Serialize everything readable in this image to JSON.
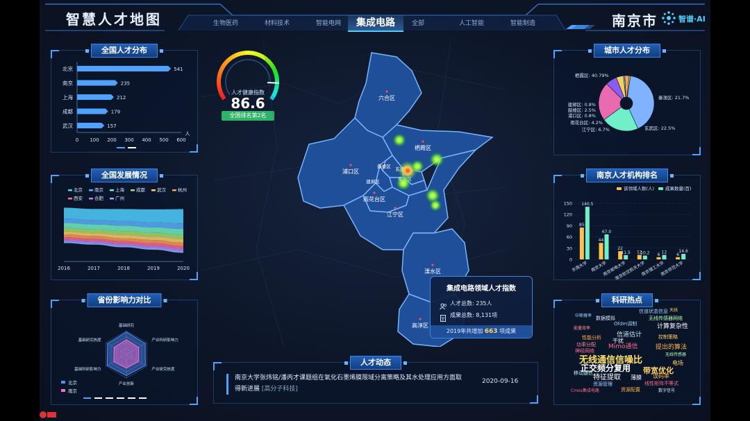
{
  "header": {
    "title": "智慧人才地图",
    "city": "南京市",
    "brand": "智谱·AI",
    "tabs": [
      {
        "label": "生物医药",
        "active": false
      },
      {
        "label": "材料技术",
        "active": false
      },
      {
        "label": "智能电网",
        "active": false
      },
      {
        "label": "集成电路",
        "active": true
      },
      {
        "label": "全部",
        "active": false
      },
      {
        "label": "人工智能",
        "active": false
      },
      {
        "label": "智能制造",
        "active": false
      }
    ]
  },
  "national": {
    "title": "全国人才分布",
    "unit": "人",
    "xticks": [
      "0",
      "100",
      "200",
      "300",
      "400",
      "500",
      "600"
    ]
  },
  "development": {
    "title": "全国发展情况",
    "legend": [
      "北京",
      "南京",
      "上海",
      "成都",
      "武汉",
      "杭州",
      "西安",
      "合肥",
      "广州"
    ],
    "years": [
      "2016",
      "2017",
      "2018",
      "2019",
      "2020"
    ]
  },
  "province": {
    "title": "省份影响力对比",
    "axes": [
      "基础研究",
      "产业科研影响力",
      "产业研究热度",
      "产业创新",
      "基础科研影响力",
      "基础研究热度"
    ],
    "legend": [
      "北京",
      "南京"
    ]
  },
  "gauge": {
    "label": "人才健康指数",
    "value": "86.6",
    "rank": "全国排名第2名"
  },
  "map": {
    "districts": [
      "六合区",
      "栖霞区",
      "浦口区",
      "鼓楼区",
      "玄武区",
      "建邺区",
      "秦淮区",
      "雨花台区",
      "江宁区",
      "溧水区",
      "高淳区"
    ]
  },
  "talent_index": {
    "title": "集成电路领域人才指数",
    "total_label": "人才总数: 235人",
    "output_label": "成果总数: 8,131项",
    "footer_prefix": "2019年共增加",
    "footer_value": "663",
    "footer_suffix": "项成果"
  },
  "news": {
    "title": "人才动态",
    "text": "南京大学张炜铭/潘丙才课题组在氧化石墨烯膜限域分离策略及其水处理应用方面取得新进展",
    "tag": "[高分子科技]",
    "date": "2020-09-16"
  },
  "city_distribution": {
    "title": "城市人才分布",
    "slices": [
      {
        "name": "栖霞区",
        "label": "栖霞区: 40.79%",
        "value": 40.79,
        "color": "#7fb3ff"
      },
      {
        "name": "秦淮区",
        "label": "秦淮区: 21.7%",
        "value": 21.7,
        "color": "#6ff0c8"
      },
      {
        "name": "玄武区",
        "label": "玄武区: 22.5%",
        "value": 22.5,
        "color": "#e86bb0"
      },
      {
        "name": "江宁区",
        "label": "江宁区: 6.7%",
        "value": 6.7,
        "color": "#8a5cf0"
      },
      {
        "name": "雨花台区",
        "label": "雨花台区: 4.2%",
        "value": 4.2,
        "color": "#f0d060"
      },
      {
        "name": "浦口区",
        "label": "浦口区: 0.8%",
        "value": 0.8,
        "color": "#4fd0ff"
      },
      {
        "name": "鼓楼区",
        "label": "鼓楼区: 2.5%",
        "value": 2.5,
        "color": "#ff9b5c"
      },
      {
        "name": "建邺区",
        "label": "建邺区: 0.8%",
        "value": 0.8,
        "color": "#b0e060"
      }
    ]
  },
  "institution": {
    "title": "南京人才机构排名",
    "legend": [
      "该领域人数(人)",
      "成果数量(百)"
    ],
    "yticks": [
      "0",
      "30",
      "60",
      "90",
      "120",
      "150"
    ]
  },
  "hotwords": {
    "title": "科研热点",
    "words": [
      {
        "text": "无线通信信噪比",
        "color": "#ffe066"
      },
      {
        "text": "正交频分复用",
        "color": "#ffffff"
      },
      {
        "text": "带宽优化",
        "color": "#ffd166"
      },
      {
        "text": "Mimo通信",
        "color": "#ff6b8b"
      },
      {
        "text": "提出的算法",
        "color": "#ffb347"
      },
      {
        "text": "特征提取",
        "color": "#ffffff"
      },
      {
        "text": "计算复杂性",
        "color": "#ffffff"
      },
      {
        "text": "信道估计",
        "color": "#c3f0ff"
      },
      {
        "text": "Ofdm调制",
        "color": "#9ad0ff"
      },
      {
        "text": "无线传感器网络",
        "color": "#b6ffb0"
      },
      {
        "text": "数据模拟",
        "color": "#e0e0ff"
      },
      {
        "text": "信道状态信息",
        "color": "#9ad0ff"
      },
      {
        "text": "性能分析",
        "color": "#ffb347"
      },
      {
        "text": "功率分配",
        "color": "#ff8f8f"
      },
      {
        "text": "干扰",
        "color": "#ffffff"
      },
      {
        "text": "控制策略",
        "color": "#ffd166"
      },
      {
        "text": "神经网络",
        "color": "#ff6b8b"
      },
      {
        "text": "资源管理",
        "color": "#9ad0ff"
      },
      {
        "text": "薄膜",
        "color": "#ffffff"
      },
      {
        "text": "误码率",
        "color": "#ffb347"
      },
      {
        "text": "移动通信",
        "color": "#c3f0ff"
      },
      {
        "text": "线性矩阵不等式",
        "color": "#ff6b8b"
      },
      {
        "text": "资源配置",
        "color": "#ffb347"
      },
      {
        "text": "电场",
        "color": "#ffd166"
      },
      {
        "text": "中断概率",
        "color": "#9ad0ff"
      },
      {
        "text": "能量效率",
        "color": "#ff8f8f"
      },
      {
        "text": "无线传感器",
        "color": "#b6ffb0"
      },
      {
        "text": "数字信号",
        "color": "#e0e0ff"
      },
      {
        "text": "天线",
        "color": "#ffd166"
      },
      {
        "text": "Cmos集成电路",
        "color": "#ff6b8b"
      }
    ]
  },
  "chart_data": [
    {
      "type": "bar",
      "title": "全国人才分布",
      "categories": [
        "北京",
        "南京",
        "上海",
        "成都",
        "武汉"
      ],
      "values": [
        541,
        235,
        212,
        179,
        157
      ],
      "xlim": [
        0,
        600
      ],
      "orientation": "horizontal"
    },
    {
      "type": "area",
      "title": "全国发展情况",
      "x": [
        "2016",
        "2017",
        "2018",
        "2019",
        "2020"
      ],
      "series": [
        {
          "name": "北京",
          "values": [
            30,
            31,
            33,
            36,
            40
          ]
        },
        {
          "name": "南京",
          "values": [
            12,
            12,
            13,
            14,
            15
          ]
        },
        {
          "name": "上海",
          "values": [
            14,
            14,
            15,
            15,
            16
          ]
        },
        {
          "name": "成都",
          "values": [
            10,
            10,
            11,
            11,
            12
          ]
        },
        {
          "name": "武汉",
          "values": [
            8,
            8,
            9,
            9,
            10
          ]
        },
        {
          "name": "杭州",
          "values": [
            8,
            8,
            8,
            9,
            9
          ]
        },
        {
          "name": "西安",
          "values": [
            6,
            6,
            7,
            7,
            7
          ]
        },
        {
          "name": "合肥",
          "values": [
            5,
            5,
            5,
            6,
            6
          ]
        },
        {
          "name": "广州",
          "values": [
            5,
            5,
            5,
            5,
            6
          ]
        }
      ],
      "colors": [
        "#4fd0ff",
        "#5ab0ff",
        "#6ff0c8",
        "#a8e070",
        "#ffd166",
        "#ff9b5c",
        "#ff6b8b",
        "#c77dff",
        "#8fb0ff"
      ]
    },
    {
      "type": "radar",
      "title": "省份影响力对比",
      "axes": [
        "基础研究",
        "产业科研影响力",
        "产业研究热度",
        "产业创新",
        "基础科研影响力",
        "基础研究热度"
      ],
      "series": [
        {
          "name": "北京",
          "values": [
            0.95,
            0.92,
            0.93,
            0.9,
            0.94,
            0.92
          ],
          "color": "#4f8fff"
        },
        {
          "name": "南京",
          "values": [
            0.62,
            0.6,
            0.6,
            0.58,
            0.62,
            0.6
          ],
          "color": "#ff6bd6"
        }
      ]
    },
    {
      "type": "pie",
      "title": "城市人才分布",
      "categories": [
        "栖霞区",
        "秦淮区",
        "玄武区",
        "江宁区",
        "雨花台区",
        "浦口区",
        "鼓楼区",
        "建邺区"
      ],
      "values": [
        40.79,
        21.7,
        22.5,
        6.7,
        4.2,
        0.8,
        2.5,
        0.8
      ]
    },
    {
      "type": "bar",
      "title": "南京人才机构排名",
      "categories": [
        "东南大学",
        "南京大学",
        "南京邮电大学",
        "南京航空航天大学",
        "南京理工大学",
        "南京师范大学"
      ],
      "series": [
        {
          "name": "该领域人数(人)",
          "values": [
            85,
            44,
            22,
            12,
            6,
            6
          ],
          "color": "#ffc04d"
        },
        {
          "name": "成果数量(百)",
          "values": [
            140.5,
            67.0,
            11.5,
            10.2,
            12,
            14.6
          ],
          "color": "#6ff0c8"
        }
      ],
      "data_labels": [
        "85",
        "140.5",
        "44",
        "67.0",
        "22",
        "11.5",
        "12",
        "10.2",
        "6",
        "12",
        "6",
        "14.6"
      ],
      "ylim": [
        0,
        150
      ]
    },
    {
      "type": "gauge",
      "title": "人才健康指数",
      "value": 86.6,
      "range": [
        0,
        100
      ]
    }
  ]
}
